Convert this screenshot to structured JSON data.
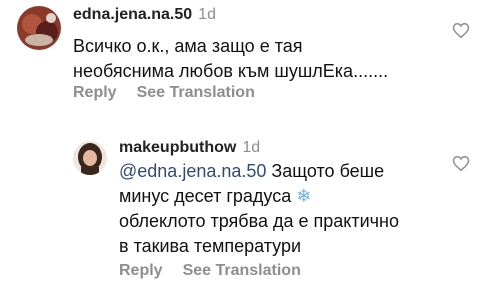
{
  "comments": [
    {
      "username": "edna.jena.na.50",
      "time": "1d",
      "lines": [
        "Всичко о.к., ама защо е тая",
        "необяснима любов към шушлЕка......."
      ],
      "actions": {
        "reply": "Reply",
        "translate": "See Translation"
      }
    },
    {
      "username": "makeupbuthow",
      "time": "1d",
      "mention": "@edna.jena.na.50",
      "lines": [
        " Защото беше",
        "минус десет градуса",
        "облеклото трябва да е практично",
        "в такива температури"
      ],
      "emoji": "❄",
      "actions": {
        "reply": "Reply",
        "translate": "See Translation"
      }
    }
  ],
  "colors": {
    "muted": "#8e8e8e",
    "mention": "#324a7a"
  }
}
